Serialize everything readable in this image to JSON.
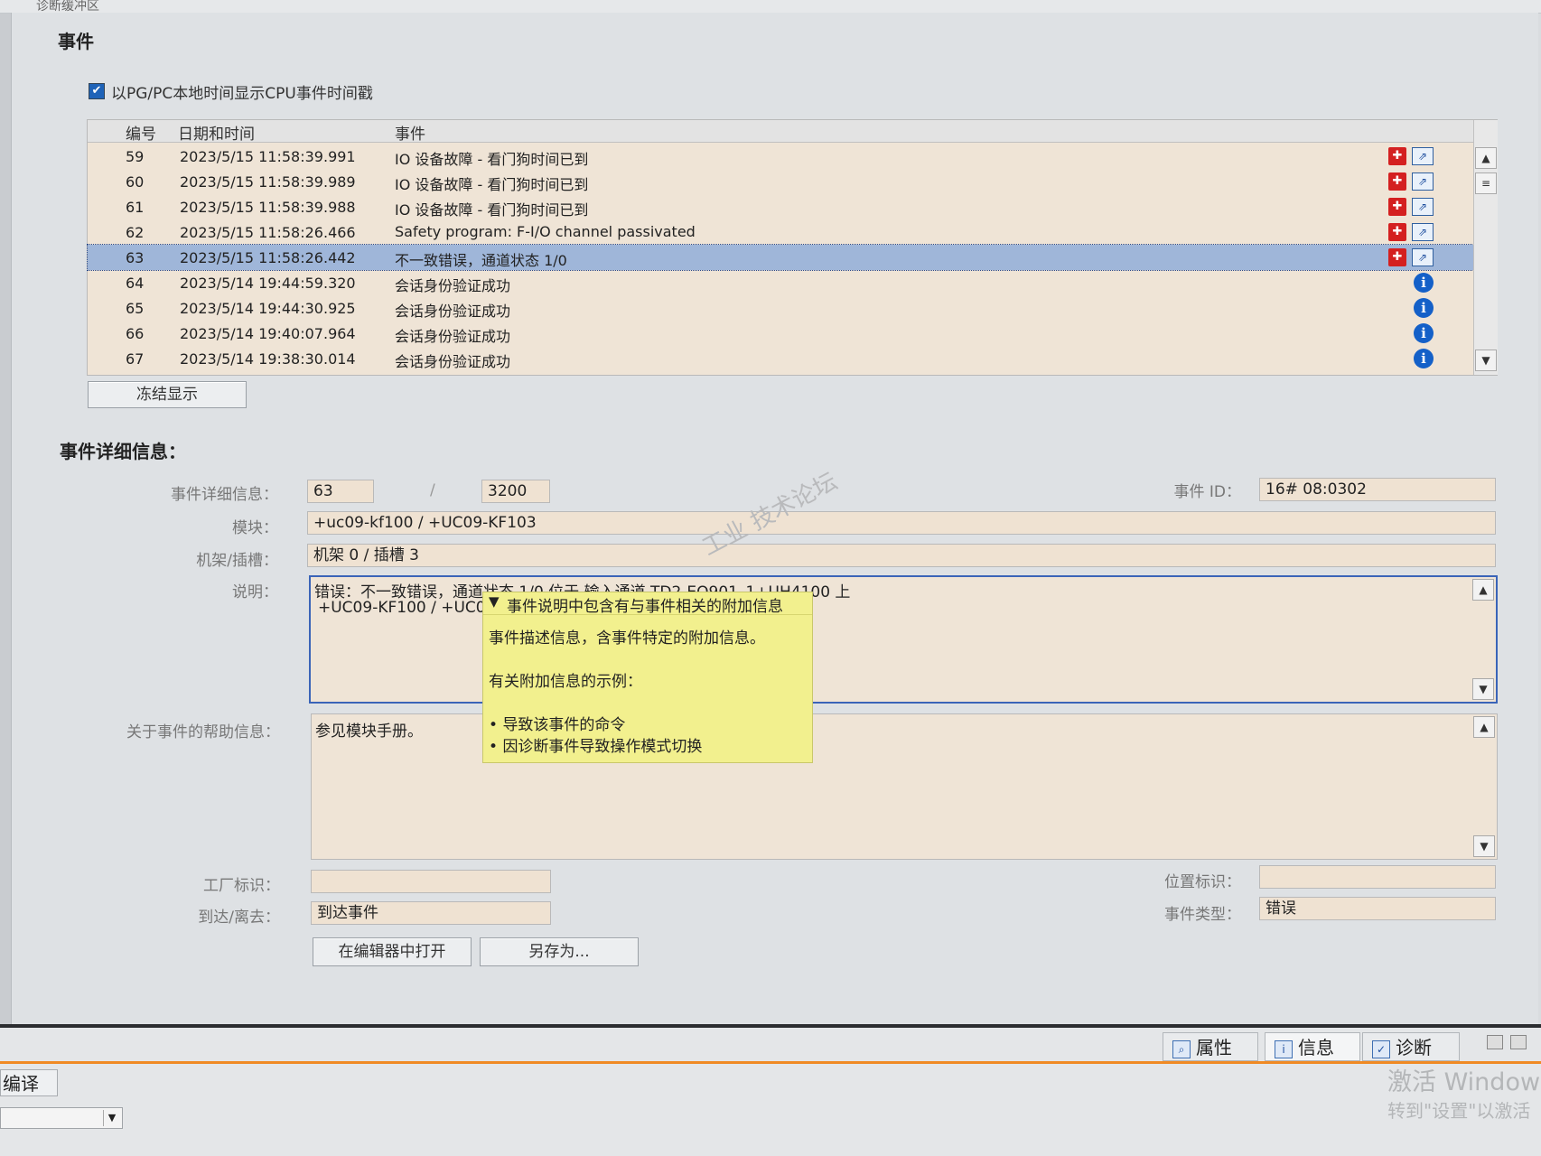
{
  "top_strip_title": "诊断缓冲区",
  "events_section": {
    "title": "事件",
    "checkbox_label": "以PG/PC本地时间显示CPU事件时间戳",
    "checkbox_checked": true,
    "columns": [
      "编号",
      "日期和时间",
      "事件"
    ],
    "rows": [
      {
        "num": "59",
        "datetime": "2023/5/15 11:58:39.991",
        "event": "IO 设备故障 - 看门狗时间已到",
        "icon": "error"
      },
      {
        "num": "60",
        "datetime": "2023/5/15 11:58:39.989",
        "event": "IO 设备故障 - 看门狗时间已到",
        "icon": "error"
      },
      {
        "num": "61",
        "datetime": "2023/5/15 11:58:39.988",
        "event": "IO 设备故障 - 看门狗时间已到",
        "icon": "error"
      },
      {
        "num": "62",
        "datetime": "2023/5/15 11:58:26.466",
        "event": "Safety program: F-I/O channel passivated",
        "icon": "error"
      },
      {
        "num": "63",
        "datetime": "2023/5/15 11:58:26.442",
        "event": "不一致错误，通道状态 1/0",
        "icon": "error",
        "selected": true
      },
      {
        "num": "64",
        "datetime": "2023/5/14 19:44:59.320",
        "event": "会话身份验证成功",
        "icon": "info"
      },
      {
        "num": "65",
        "datetime": "2023/5/14 19:44:30.925",
        "event": "会话身份验证成功",
        "icon": "info"
      },
      {
        "num": "66",
        "datetime": "2023/5/14 19:40:07.964",
        "event": "会话身份验证成功",
        "icon": "info"
      },
      {
        "num": "67",
        "datetime": "2023/5/14 19:38:30.014",
        "event": "会话身份验证成功",
        "icon": "info"
      }
    ],
    "freeze_button": "冻结显示"
  },
  "details": {
    "title": "事件详细信息：",
    "detail_label": "事件详细信息：",
    "detail_value1": "63",
    "detail_separator": "/",
    "detail_value2": "3200",
    "event_id_label": "事件 ID：",
    "event_id_value": "16# 08:0302",
    "module_label": "模块：",
    "module_value": "+uc09-kf100 / +UC09-KF103",
    "rack_label": "机架/插槽：",
    "rack_value": "机架 0 / 插槽 3",
    "desc_label": "说明：",
    "desc_line1": "错误：不一致错误，通道状态 1/0 位于 输入通道 TD2-EQ901_1+UH4100 上",
    "desc_line2": "+UC09-KF100 / +UC09-",
    "help_label": "关于事件的帮助信息：",
    "help_value": "参见模块手册。",
    "plant_label": "工厂标识：",
    "plant_value": "",
    "location_label": "位置标识：",
    "location_value": "",
    "arrive_label": "到达/离去：",
    "arrive_value": "到达事件",
    "type_label": "事件类型：",
    "type_value": "错误",
    "open_editor_button": "在编辑器中打开",
    "save_as_button": "另存为..."
  },
  "tooltip": {
    "header": "事件说明中包含有与事件相关的附加信息",
    "line1": "事件描述信息，含事件特定的附加信息。",
    "line2": "有关附加信息的示例：",
    "bullet1": "导致该事件的命令",
    "bullet2": "因诊断事件导致操作模式切换"
  },
  "bottom_tabs": [
    "属性",
    "信息",
    "诊断"
  ],
  "bottom_left_tab": "编译",
  "windows_activation": {
    "line1": "激活 Windows",
    "line2": "转到\"设置\"以激活"
  },
  "watermark": "工业 技术论坛",
  "colors": {
    "row_bg": "#efe4d6",
    "selected_row": "#9fb6d9",
    "error_icon": "#d42020",
    "info_icon": "#1460c8",
    "tooltip_bg": "#f2f08e",
    "tab_accent": "#f08a24"
  },
  "icons": {
    "error": "wrench-error-icon",
    "doc": "document-arrow-icon",
    "info": "info-icon"
  }
}
